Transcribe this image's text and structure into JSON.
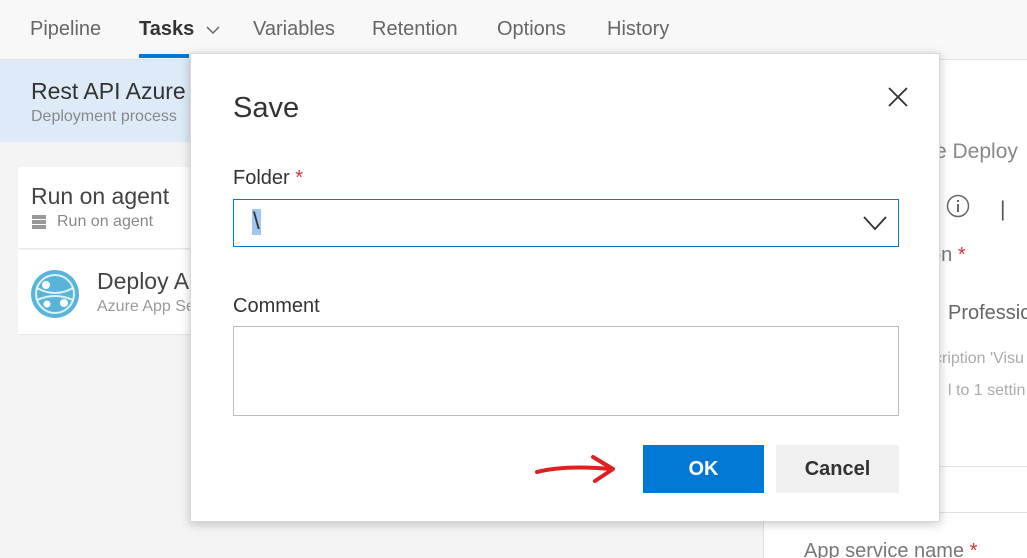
{
  "nav": {
    "tabs": [
      {
        "label": "Pipeline"
      },
      {
        "label": "Tasks"
      },
      {
        "label": "Variables"
      },
      {
        "label": "Retention"
      },
      {
        "label": "Options"
      },
      {
        "label": "History"
      }
    ],
    "active_tab": "Tasks"
  },
  "left_panel": {
    "process_title": "Rest API Azure",
    "process_subtitle": "Deployment process",
    "agent": {
      "title": "Run on agent",
      "subtitle": "Run on agent"
    },
    "task": {
      "title": "Deploy A",
      "subtitle": "Azure App Se"
    }
  },
  "right_panel": {
    "text1": "re Deploy",
    "separator": "|",
    "text2": "tion",
    "required_mark": "*",
    "text3": "Professio",
    "text4": "cription 'Visu",
    "text5": "l to 1 settin",
    "app_service_label": "App service name",
    "app_service_required": "*"
  },
  "dialog": {
    "title": "Save",
    "folder_label": "Folder",
    "folder_required": "*",
    "folder_value": "\\",
    "comment_label": "Comment",
    "comment_value": "",
    "ok_label": "OK",
    "cancel_label": "Cancel"
  },
  "colors": {
    "accent": "#0078d4",
    "required": "#d13438",
    "annotation_arrow": "#e02020"
  }
}
